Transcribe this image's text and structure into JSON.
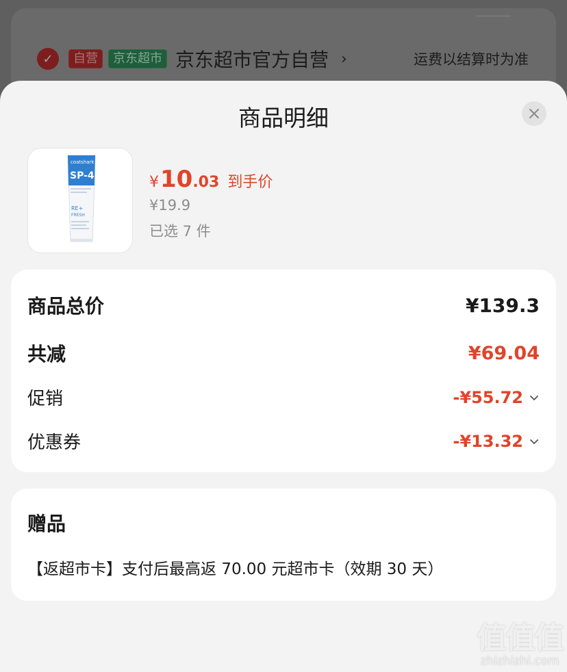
{
  "background": {
    "store_tag_self": "自营",
    "store_tag_market": "京东超市",
    "store_name": "京东超市官方自营",
    "chevron": "›",
    "shipping_note": "运费以结算时为准"
  },
  "sheet": {
    "title": "商品明细",
    "close_icon": "close-icon"
  },
  "product": {
    "image_icon": "toothpaste-product-image",
    "price_currency": "¥",
    "price_integer": "10",
    "price_decimal": ".03",
    "price_label": "到手价",
    "original_price": "¥19.9",
    "quantity_text": "已选 7 件"
  },
  "summary": {
    "total_label": "商品总价",
    "total_value": "¥139.3",
    "discount_label": "共减",
    "discount_value": "¥69.04",
    "promotion_label": "促销",
    "promotion_value": "-¥55.72",
    "coupon_label": "优惠券",
    "coupon_value": "-¥13.32"
  },
  "gift": {
    "title": "赠品",
    "description": "【返超市卡】支付后最高返 70.00 元超市卡（效期 30 天）"
  },
  "watermark": {
    "logo": "值值值",
    "url": "zhizhizhi.com"
  },
  "colors": {
    "accent_red": "#e0442a",
    "text": "#1a1a1a",
    "muted": "#8c8c8c",
    "sheet_bg": "#f3f3f3"
  }
}
